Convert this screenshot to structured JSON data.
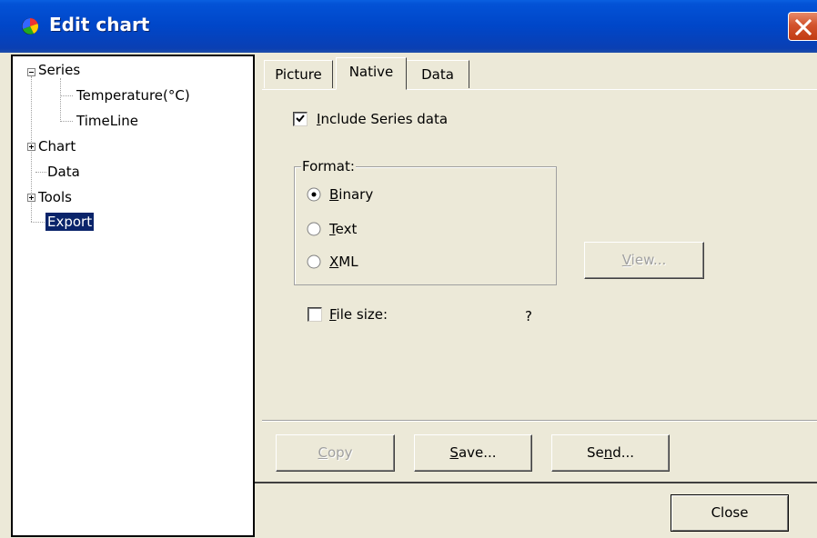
{
  "window": {
    "title": "Edit chart",
    "close_icon": "close-x-icon",
    "app_icon": "teechart-icon"
  },
  "tree": {
    "items": [
      {
        "label": "Series",
        "expander": "minus"
      },
      {
        "label": "Temperature(°C)"
      },
      {
        "label": "TimeLine"
      },
      {
        "label": "Chart",
        "expander": "plus"
      },
      {
        "label": "Data"
      },
      {
        "label": "Tools",
        "expander": "plus"
      },
      {
        "label": "Export",
        "selected": true
      }
    ]
  },
  "tabs": [
    {
      "label": "Picture",
      "active": false
    },
    {
      "label": "Native",
      "active": true
    },
    {
      "label": "Data",
      "active": false
    }
  ],
  "native": {
    "include_series": {
      "label": "Include Series data",
      "checked": true
    },
    "format": {
      "title": "Format:",
      "options": [
        {
          "label": "Binary",
          "selected": true
        },
        {
          "label": "Text",
          "selected": false
        },
        {
          "label": "XML",
          "selected": false
        }
      ]
    },
    "view_button": "View...",
    "file_size": {
      "label": "File size:",
      "checked": false,
      "value": "?"
    }
  },
  "action_buttons": {
    "copy": "Copy",
    "save": "Save...",
    "send": "Send..."
  },
  "footer": {
    "close": "Close"
  }
}
